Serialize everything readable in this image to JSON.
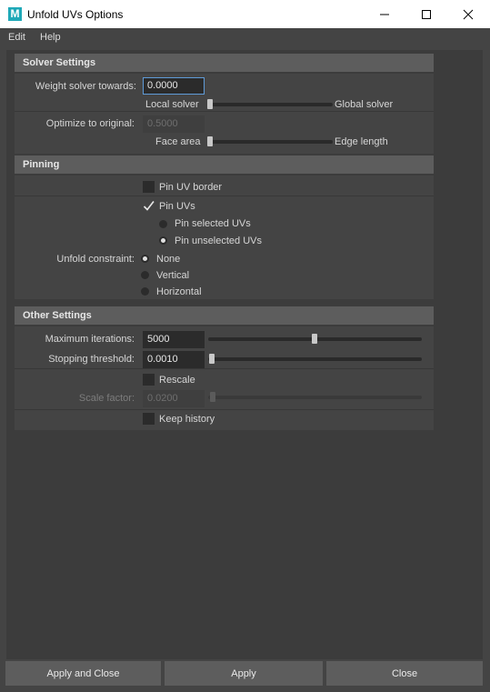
{
  "window": {
    "icon_letter": "M",
    "title": "Unfold UVs Options"
  },
  "menu": [
    "Edit",
    "Help"
  ],
  "solver": {
    "header": "Solver Settings",
    "weight_label": "Weight solver towards:",
    "weight_value": "0.0000",
    "weight_slider_fraction": 0.0,
    "weight_left": "Local solver",
    "weight_right": "Global solver",
    "optimize_label": "Optimize to original:",
    "optimize_value": "0.5000",
    "optimize_slider_fraction": 0.0,
    "optimize_left": "Face area",
    "optimize_right": "Edge length"
  },
  "pinning": {
    "header": "Pinning",
    "pin_border_label": "Pin UV border",
    "pin_border_checked": false,
    "pin_uvs_label": "Pin UVs",
    "pin_uvs_checked": true,
    "pin_selected_label": "Pin selected UVs",
    "pin_unselected_label": "Pin unselected UVs",
    "pin_mode": "unselected",
    "constraint_label": "Unfold constraint:",
    "constraint_options": [
      "None",
      "Vertical",
      "Horizontal"
    ],
    "constraint_selected": "None"
  },
  "other": {
    "header": "Other Settings",
    "max_iter_label": "Maximum iterations:",
    "max_iter_value": "5000",
    "max_iter_slider_fraction": 0.5,
    "stop_label": "Stopping threshold:",
    "stop_value": "0.0010",
    "stop_slider_fraction": 0.0,
    "rescale_label": "Rescale",
    "rescale_checked": false,
    "scale_label": "Scale factor:",
    "scale_value": "0.0200",
    "scale_slider_fraction": 0.0,
    "keep_history_label": "Keep history",
    "keep_history_checked": false
  },
  "buttons": {
    "apply_close": "Apply and Close",
    "apply": "Apply",
    "close": "Close"
  }
}
